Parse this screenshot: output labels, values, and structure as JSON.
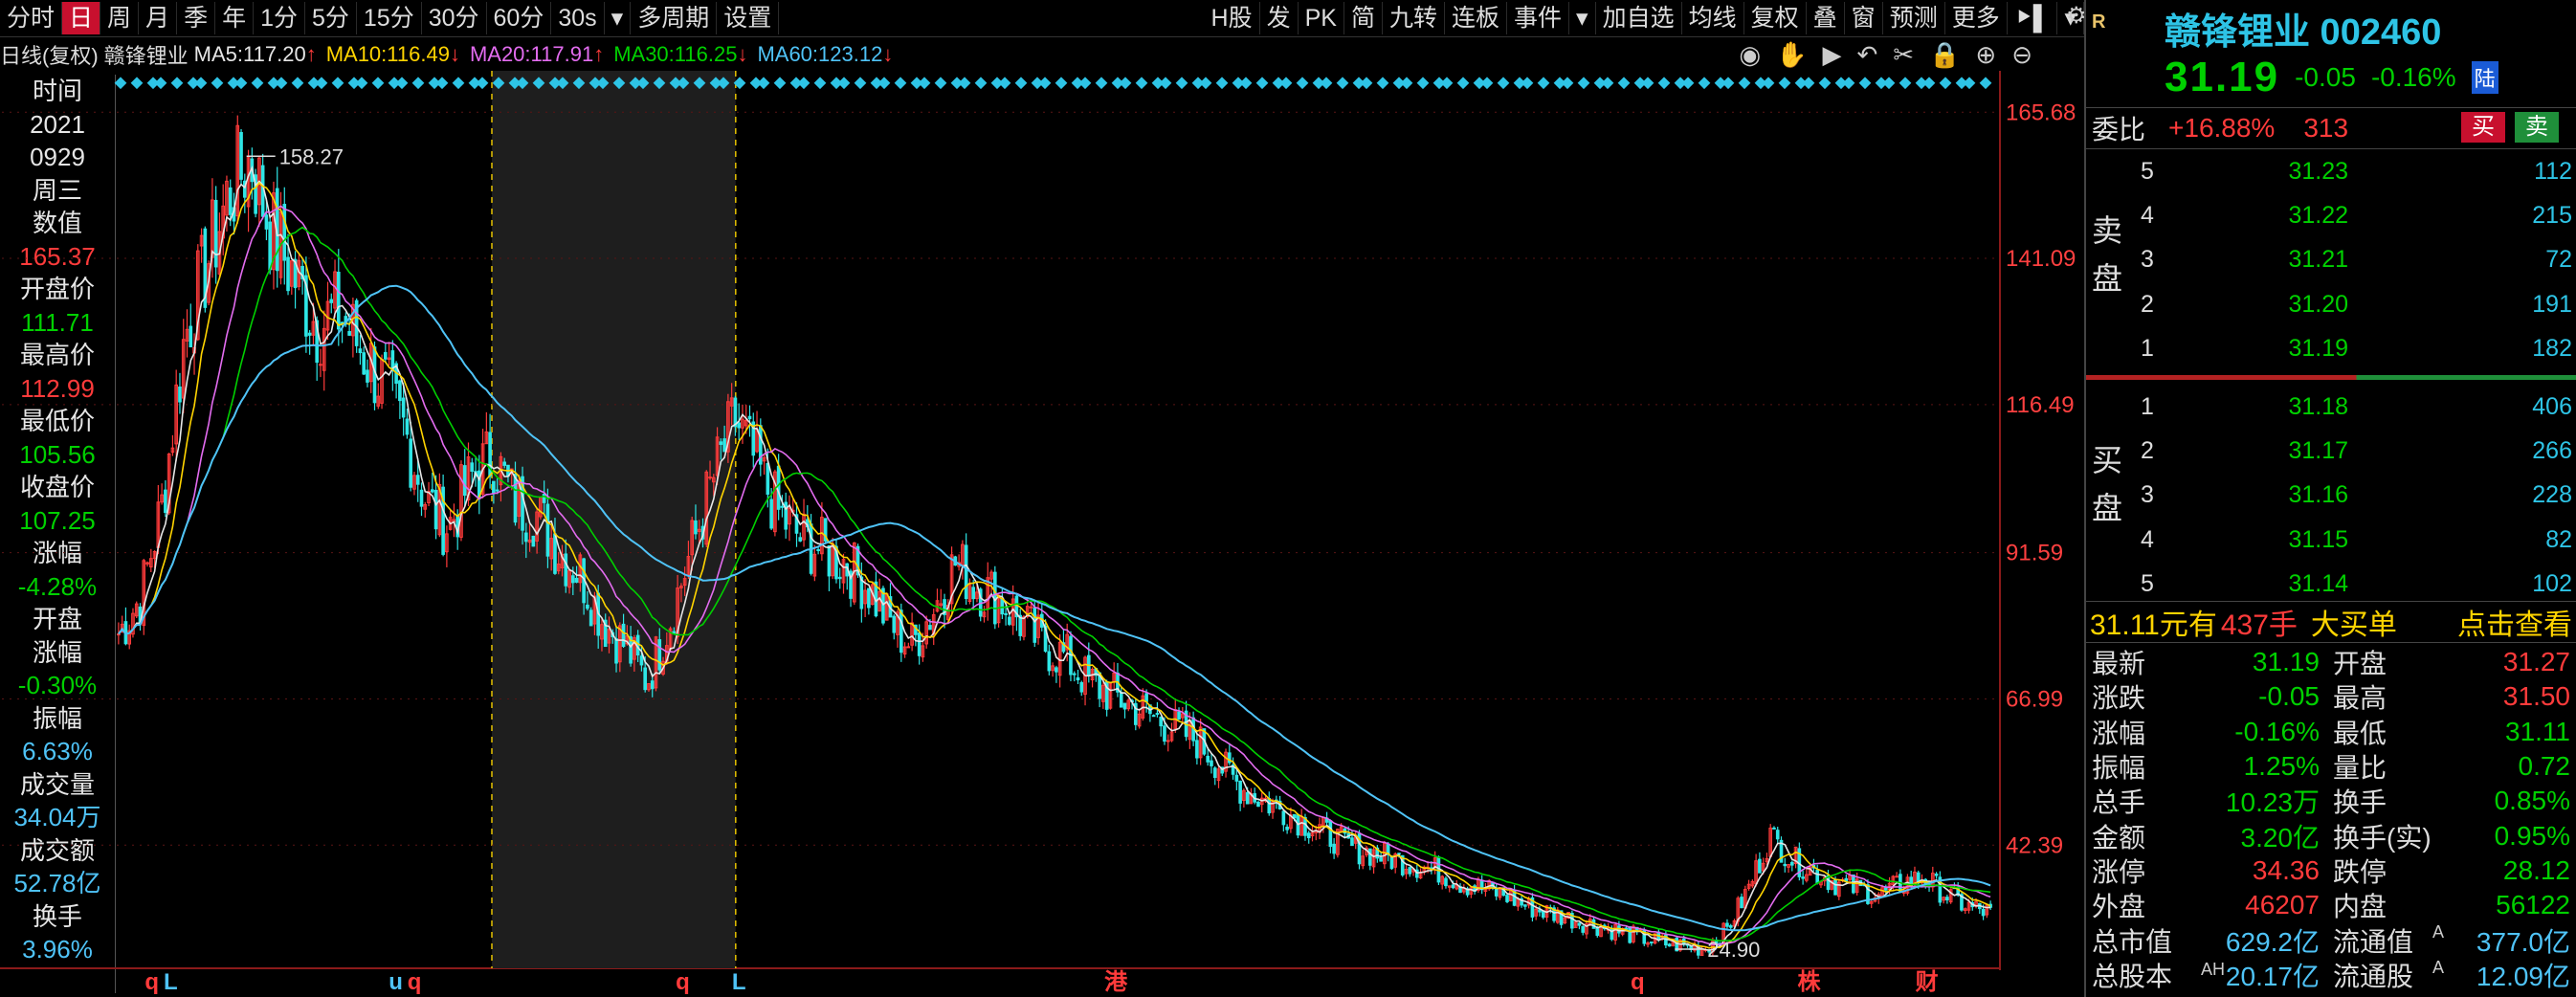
{
  "toolbar": {
    "left": [
      "分时",
      "日",
      "周",
      "月",
      "季",
      "年",
      "1分",
      "5分",
      "15分",
      "30分",
      "60分",
      "30s",
      "▾",
      "多周期",
      "设置"
    ],
    "active_index": 1,
    "right": [
      "H股",
      "发",
      "PK",
      "简",
      "九转",
      "连板",
      "事件",
      "▾",
      "加自选",
      "均线",
      "复权",
      "叠",
      "窗",
      "预测",
      "更多",
      "⯈▌",
      "▾"
    ]
  },
  "legend": {
    "period": "日线(复权)",
    "name": "赣锋锂业",
    "ma": [
      {
        "label": "MA5:",
        "value": "117.20",
        "arrow": "↑",
        "color": "#e6e6e6"
      },
      {
        "label": "MA10:",
        "value": "116.49",
        "arrow": "↓",
        "color": "#ffd400"
      },
      {
        "label": "MA20:",
        "value": "117.91",
        "arrow": "↑",
        "color": "#e36cf0"
      },
      {
        "label": "MA30:",
        "value": "116.25",
        "arrow": "↓",
        "color": "#00d000"
      },
      {
        "label": "MA60:",
        "value": "123.12",
        "arrow": "↓",
        "color": "#4fc3f7"
      }
    ],
    "tools": [
      "◉",
      "✋",
      "▶",
      "↶",
      "✂",
      "🔒",
      "⊕",
      "⊖"
    ]
  },
  "info_panel": [
    {
      "t": "时间",
      "c": "#e6e6e6"
    },
    {
      "t": "2021",
      "c": "#e6e6e6"
    },
    {
      "t": "0929",
      "c": "#e6e6e6"
    },
    {
      "t": "周三",
      "c": "#e6e6e6"
    },
    {
      "t": "数值",
      "c": "#e6e6e6"
    },
    {
      "t": "165.37",
      "c": "#ff3b3b"
    },
    {
      "t": "开盘价",
      "c": "#e6e6e6"
    },
    {
      "t": "111.71",
      "c": "#00d000"
    },
    {
      "t": "最高价",
      "c": "#e6e6e6"
    },
    {
      "t": "112.99",
      "c": "#ff3b3b"
    },
    {
      "t": "最低价",
      "c": "#e6e6e6"
    },
    {
      "t": "105.56",
      "c": "#00d000"
    },
    {
      "t": "收盘价",
      "c": "#e6e6e6"
    },
    {
      "t": "107.25",
      "c": "#00d000"
    },
    {
      "t": "涨幅",
      "c": "#e6e6e6"
    },
    {
      "t": "-4.28%",
      "c": "#00d000"
    },
    {
      "t": "开盘",
      "c": "#e6e6e6"
    },
    {
      "t": "涨幅",
      "c": "#e6e6e6"
    },
    {
      "t": "-0.30%",
      "c": "#00d000"
    },
    {
      "t": "振幅",
      "c": "#e6e6e6"
    },
    {
      "t": "6.63%",
      "c": "#4fc3f7"
    },
    {
      "t": "成交量",
      "c": "#e6e6e6"
    },
    {
      "t": "34.04万",
      "c": "#4fc3f7"
    },
    {
      "t": "成交额",
      "c": "#e6e6e6"
    },
    {
      "t": "52.78亿",
      "c": "#4fc3f7"
    },
    {
      "t": "换手",
      "c": "#e6e6e6"
    },
    {
      "t": "3.96%",
      "c": "#4fc3f7"
    }
  ],
  "chart_data": {
    "type": "candlestick",
    "y_axis_ticks": [
      "165.68",
      "141.09",
      "116.49",
      "91.59",
      "66.99",
      "42.39"
    ],
    "ylim": [
      22,
      172
    ],
    "annotations": [
      {
        "label": "158.27",
        "kind": "high",
        "value": 158.27
      },
      {
        "label": "24.90",
        "kind": "low",
        "value": 24.9
      }
    ],
    "highlight_range": [
      0.2,
      0.33
    ],
    "close_path": [
      78,
      84,
      100,
      128,
      140,
      152,
      158,
      145,
      138,
      130,
      132,
      126,
      120,
      112,
      100,
      96,
      104,
      108,
      100,
      98,
      92,
      88,
      80,
      76,
      70,
      80,
      92,
      104,
      114,
      106,
      98,
      94,
      92,
      90,
      86,
      80,
      76,
      82,
      90,
      86,
      84,
      80,
      76,
      74,
      70,
      68,
      66,
      64,
      62,
      60,
      56,
      52,
      50,
      48,
      46,
      44,
      42,
      41,
      40,
      39,
      38,
      36,
      35,
      34,
      32,
      31,
      30,
      29,
      28,
      27,
      26,
      25.5,
      25,
      28,
      35,
      44,
      40,
      38,
      36,
      35,
      34,
      36,
      37,
      34,
      32,
      31
    ],
    "ma_series": [
      {
        "color": "#e6e6e6"
      },
      {
        "color": "#ffd400"
      },
      {
        "color": "#e36cf0"
      },
      {
        "color": "#00d000"
      },
      {
        "color": "#4fc3f7"
      }
    ],
    "event_markers": [
      {
        "label": "q",
        "color": "#ff3b3b"
      },
      {
        "label": "L",
        "color": "#4fc3f7"
      },
      {
        "label": "u",
        "color": "#4fc3f7"
      },
      {
        "label": "q",
        "color": "#ff3b3b"
      },
      {
        "label": "q",
        "color": "#ff3b3b"
      },
      {
        "label": "L",
        "color": "#4fc3f7"
      },
      {
        "label": "港",
        "color": "#ff3b3b"
      },
      {
        "label": "q",
        "color": "#ff3b3b"
      },
      {
        "label": "株",
        "color": "#ff3b3b"
      },
      {
        "label": "财",
        "color": "#ff3b3b"
      }
    ]
  },
  "quote": {
    "badge": "R",
    "name_code": "赣锋锂业 002460",
    "price": "31.19",
    "change": "-0.05",
    "pct": "-0.16%",
    "lu": "陆",
    "webi_label": "委比",
    "webi_value": "+16.88%",
    "webi_diff": "313",
    "buy_btn": "买",
    "sell_btn": "卖",
    "sell_side_label": [
      "卖",
      "盘"
    ],
    "buy_side_label": [
      "买",
      "盘"
    ],
    "asks": [
      {
        "lv": "5",
        "px": "31.23",
        "vol": "112"
      },
      {
        "lv": "4",
        "px": "31.22",
        "vol": "215"
      },
      {
        "lv": "3",
        "px": "31.21",
        "vol": "72"
      },
      {
        "lv": "2",
        "px": "31.20",
        "vol": "191"
      },
      {
        "lv": "1",
        "px": "31.19",
        "vol": "182"
      }
    ],
    "bids": [
      {
        "lv": "1",
        "px": "31.18",
        "vol": "406"
      },
      {
        "lv": "2",
        "px": "31.17",
        "vol": "266"
      },
      {
        "lv": "3",
        "px": "31.16",
        "vol": "228"
      },
      {
        "lv": "4",
        "px": "31.15",
        "vol": "82"
      },
      {
        "lv": "5",
        "px": "31.14",
        "vol": "102"
      }
    ],
    "big_order": {
      "price": "31.11元有",
      "qty": "437手",
      "text": "大买单",
      "link": "点击查看"
    },
    "stats": [
      {
        "l": "最新",
        "lv": "31.19",
        "lc": "#00d000",
        "r": "开盘",
        "rv": "31.27",
        "rc": "#ff3b3b"
      },
      {
        "l": "涨跌",
        "lv": "-0.05",
        "lc": "#00d000",
        "r": "最高",
        "rv": "31.50",
        "rc": "#ff3b3b"
      },
      {
        "l": "涨幅",
        "lv": "-0.16%",
        "lc": "#00d000",
        "r": "最低",
        "rv": "31.11",
        "rc": "#00d000"
      },
      {
        "l": "振幅",
        "lv": "1.25%",
        "lc": "#00d000",
        "r": "量比",
        "rv": "0.72",
        "rc": "#00d000"
      },
      {
        "l": "总手",
        "lv": "10.23万",
        "lc": "#00d000",
        "r": "换手",
        "rv": "0.85%",
        "rc": "#00d000"
      },
      {
        "l": "金额",
        "lv": "3.20亿",
        "lc": "#00d000",
        "r": "换手(实)",
        "rv": "0.95%",
        "rc": "#00d000"
      },
      {
        "l": "涨停",
        "lv": "34.36",
        "lc": "#ff3b3b",
        "r": "跌停",
        "rv": "28.12",
        "rc": "#00d000"
      },
      {
        "l": "外盘",
        "lv": "46207",
        "lc": "#ff3b3b",
        "r": "内盘",
        "rv": "56122",
        "rc": "#00d000"
      },
      {
        "l": "总市值",
        "lv": "629.2亿",
        "lc": "#4fc3f7",
        "r": "流通值",
        "rv": "377.0亿",
        "rc": "#4fc3f7",
        "rsup": "A"
      },
      {
        "l": "总股本",
        "lsup": "AH",
        "lv": "20.17亿",
        "lc": "#4fc3f7",
        "r": "流通股",
        "rv": "12.09亿",
        "rc": "#4fc3f7",
        "rsup": "A"
      }
    ]
  }
}
